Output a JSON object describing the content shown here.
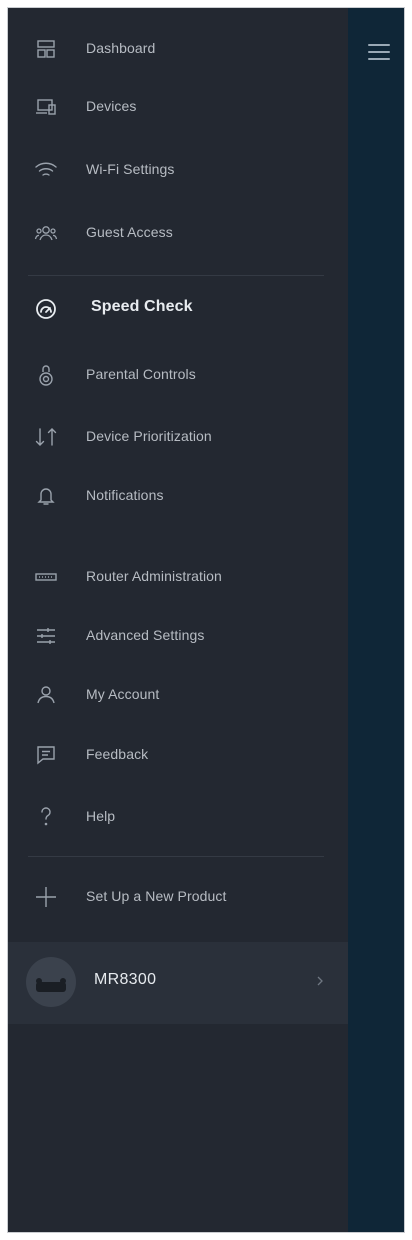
{
  "menu": {
    "items": [
      {
        "label": "Dashboard",
        "icon": "dashboard-icon"
      },
      {
        "label": "Devices",
        "icon": "devices-icon"
      },
      {
        "label": "Wi-Fi Settings",
        "icon": "wifi-icon"
      },
      {
        "label": "Guest Access",
        "icon": "guest-access-icon"
      },
      {
        "label": "Speed Check",
        "icon": "speedometer-icon",
        "active": true
      },
      {
        "label": "Parental Controls",
        "icon": "parental-lock-icon"
      },
      {
        "label": "Device Prioritization",
        "icon": "priority-arrows-icon"
      },
      {
        "label": "Notifications",
        "icon": "bell-icon"
      },
      {
        "label": "Router Administration",
        "icon": "router-icon"
      },
      {
        "label": "Advanced Settings",
        "icon": "sliders-icon"
      },
      {
        "label": "My Account",
        "icon": "person-icon"
      },
      {
        "label": "Feedback",
        "icon": "feedback-icon"
      },
      {
        "label": "Help",
        "icon": "question-icon"
      },
      {
        "label": "Set Up a New Product",
        "icon": "plus-icon"
      }
    ]
  },
  "router": {
    "name": "MR8300"
  },
  "colors": {
    "drawer_bg": "#232831",
    "right_pane_bg": "#0f2637",
    "text": "#b7bcc3",
    "active_text": "#e8ecf0",
    "icon": "#9aa2ac"
  }
}
